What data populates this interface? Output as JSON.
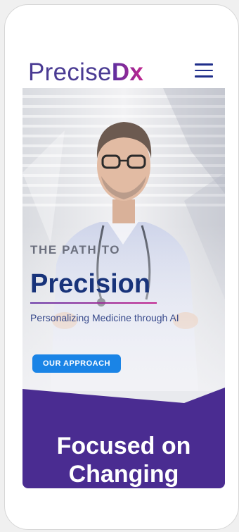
{
  "header": {
    "logo_main": "Precise",
    "logo_accent": "Dx",
    "menu_icon": "hamburger-menu-icon"
  },
  "hero": {
    "kicker": "THE PATH TO",
    "title": "Precision",
    "subtitle": "Personalizing Medicine through AI",
    "cta_label": "OUR APPROACH"
  },
  "section": {
    "title_line1": "Focused on",
    "title_line2": "Changing"
  },
  "colors": {
    "brand_purple": "#4a3b93",
    "accent_magenta": "#c2258f",
    "navy": "#18337a",
    "cta_blue": "#1a84e6",
    "section_purple": "#4a2c91"
  }
}
